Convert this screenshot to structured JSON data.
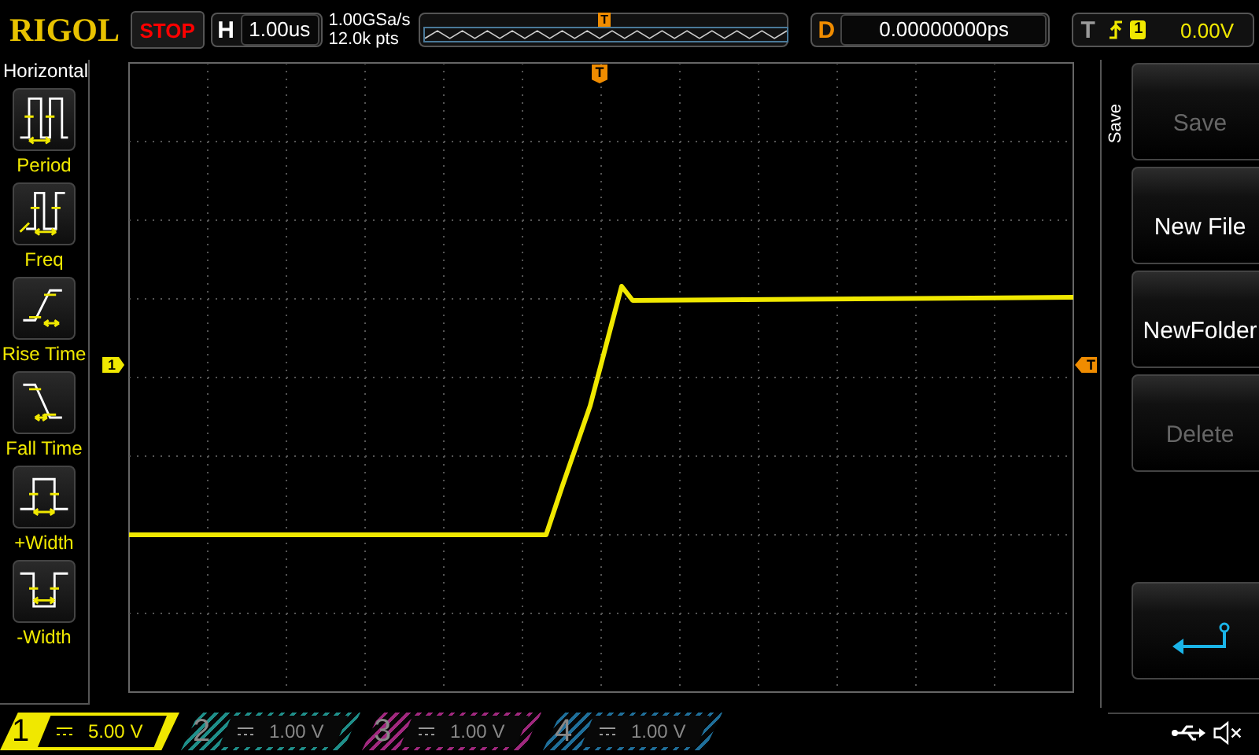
{
  "header": {
    "logo": "RIGOL",
    "run_state": "STOP",
    "timebase": {
      "label": "H",
      "value": "1.00us"
    },
    "sample_rate": "1.00GSa/s",
    "memory_depth": "12.0k pts",
    "memory_marker": "T",
    "delay": {
      "label": "D",
      "value": "0.00000000ps"
    },
    "trigger": {
      "label": "T",
      "source": "1",
      "level": "0.00V"
    }
  },
  "measure_panel": {
    "title": "Horizontal",
    "items": [
      {
        "kind": "period",
        "label": "Period"
      },
      {
        "kind": "freq",
        "label": "Freq"
      },
      {
        "kind": "rise",
        "label": "Rise Time"
      },
      {
        "kind": "fall",
        "label": "Fall Time"
      },
      {
        "kind": "pwidth",
        "label": "+Width"
      },
      {
        "kind": "nwidth",
        "label": "-Width"
      }
    ]
  },
  "plot": {
    "channel_marker": "1",
    "trigger_position_marker": "T",
    "trigger_level_marker": "T"
  },
  "menu": {
    "title": "Save",
    "buttons": [
      {
        "kind": "text",
        "label": "Save",
        "disabled": true
      },
      {
        "kind": "text",
        "label": "New File",
        "disabled": false
      },
      {
        "kind": "text",
        "label": "NewFolder",
        "disabled": false
      },
      {
        "kind": "text",
        "label": "Delete",
        "disabled": true
      },
      {
        "kind": "spacer"
      },
      {
        "kind": "back"
      }
    ]
  },
  "channels": [
    {
      "number": "1",
      "scale": "5.00 V",
      "selected": true,
      "color": "#f0e800"
    },
    {
      "number": "2",
      "scale": "1.00 V",
      "selected": false,
      "color": "#1f8f8a"
    },
    {
      "number": "3",
      "scale": "1.00 V",
      "selected": false,
      "color": "#a0287e"
    },
    {
      "number": "4",
      "scale": "1.00 V",
      "selected": false,
      "color": "#1f6f9a"
    }
  ]
}
